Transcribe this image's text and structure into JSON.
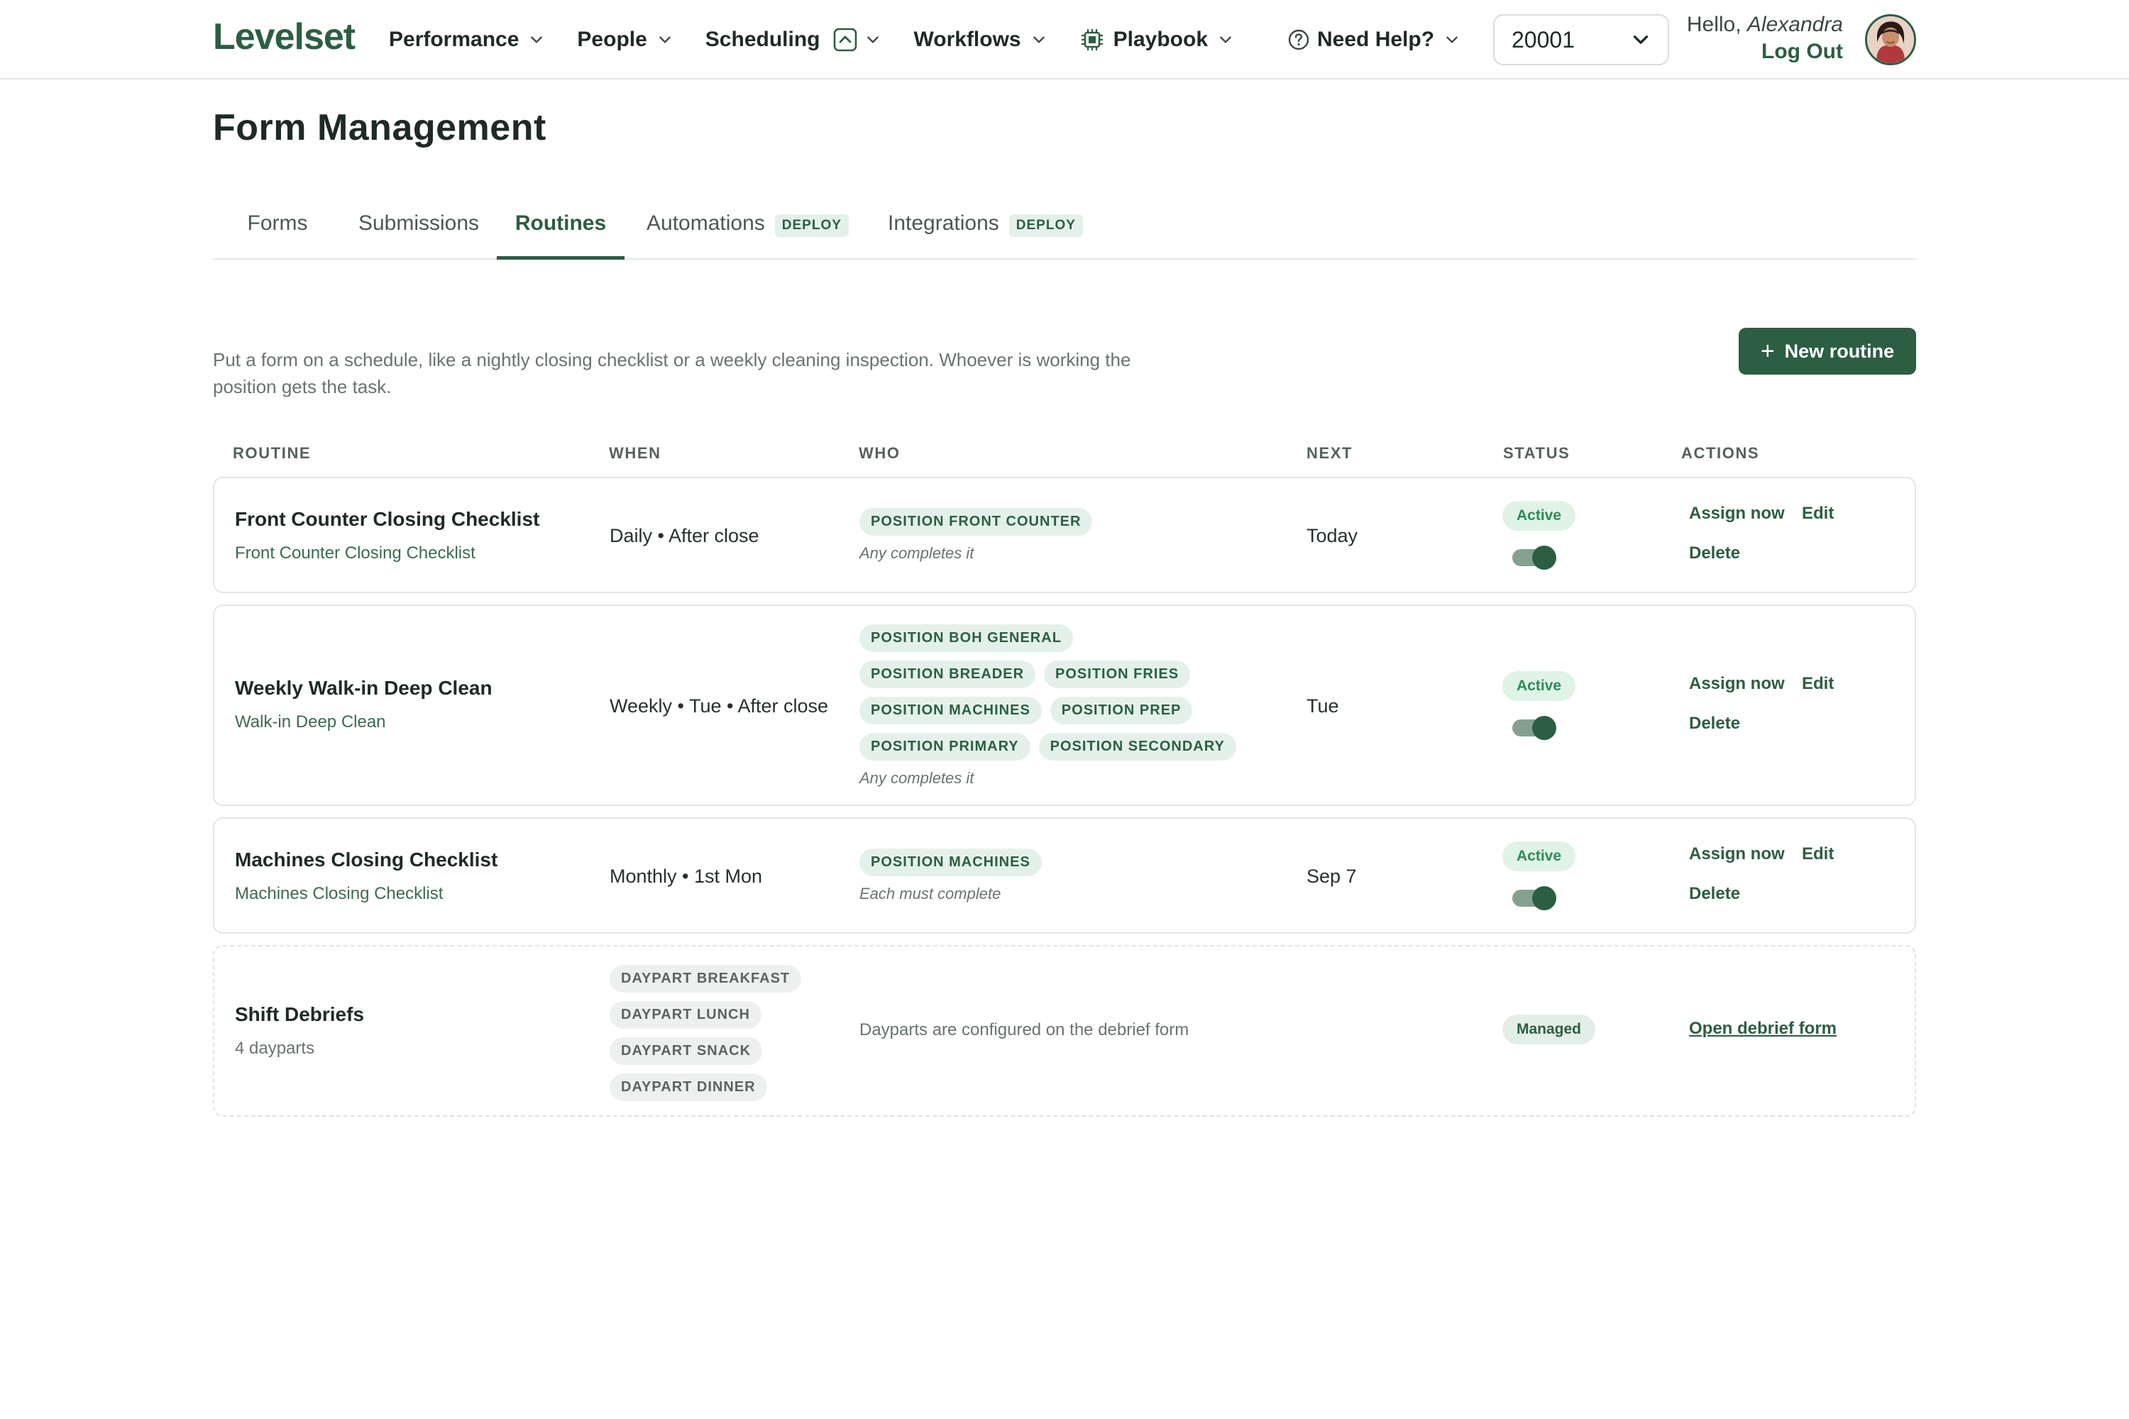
{
  "app": {
    "logo": "Levelset",
    "nav": [
      {
        "label": "Performance"
      },
      {
        "label": "People"
      },
      {
        "label": "Scheduling"
      },
      {
        "label": "Workflows"
      },
      {
        "label": "Playbook"
      }
    ],
    "help_label": "Need Help?",
    "location_value": "20001",
    "greeting_hello": "Hello,",
    "greeting_name": "Alexandra",
    "logout_label": "Log Out"
  },
  "page": {
    "title": "Form Management",
    "tabs": [
      {
        "label": "Forms"
      },
      {
        "label": "Submissions"
      },
      {
        "label": "Routines",
        "active": true
      },
      {
        "label": "Automations",
        "badge": "DEPLOY"
      },
      {
        "label": "Integrations",
        "badge": "DEPLOY"
      }
    ],
    "description": "Put a form on a schedule, like a nightly closing checklist or a weekly cleaning inspection. Whoever is working the position gets the task.",
    "new_button_label": "New routine"
  },
  "table": {
    "headers": [
      "ROUTINE",
      "WHEN",
      "WHO",
      "NEXT",
      "STATUS",
      "ACTIONS"
    ],
    "rows": [
      {
        "title": "Front Counter Closing Checklist",
        "form": "Front Counter Closing Checklist",
        "when": "Daily • After close",
        "who": [
          "POSITION FRONT COUNTER"
        ],
        "completion": "Any completes it",
        "next": "Today",
        "status": "Active",
        "toggle_on": true,
        "actions": {
          "assign": "Assign now",
          "edit": "Edit",
          "delete": "Delete"
        }
      },
      {
        "title": "Weekly Walk-in Deep Clean",
        "form": "Walk-in Deep Clean",
        "when": "Weekly • Tue • After close",
        "who": [
          "POSITION BOH GENERAL",
          "POSITION BREADER",
          "POSITION FRIES",
          "POSITION MACHINES",
          "POSITION PREP",
          "POSITION PRIMARY",
          "POSITION SECONDARY"
        ],
        "completion": "Any completes it",
        "next": "Tue",
        "status": "Active",
        "toggle_on": true,
        "actions": {
          "assign": "Assign now",
          "edit": "Edit",
          "delete": "Delete"
        }
      },
      {
        "title": "Machines Closing Checklist",
        "form": "Machines Closing Checklist",
        "when": "Monthly • 1st Mon",
        "who": [
          "POSITION MACHINES"
        ],
        "completion": "Each must complete",
        "next": "Sep 7",
        "status": "Active",
        "toggle_on": true,
        "actions": {
          "assign": "Assign now",
          "edit": "Edit",
          "delete": "Delete"
        }
      },
      {
        "title": "Shift Debriefs",
        "form": "4 dayparts",
        "when_chips": [
          "DAYPART BREAKFAST",
          "DAYPART LUNCH",
          "DAYPART SNACK",
          "DAYPART DINNER"
        ],
        "who_note": "Dayparts are configured on the debrief form",
        "status": "Managed",
        "actions": {
          "open": "Open debrief form"
        }
      }
    ]
  },
  "colors": {
    "brand": "#2c5e42",
    "chip_bg": "#e4f1ea",
    "active_text": "#2f8a58"
  },
  "icons": [
    "chevron-down-icon",
    "scheduling-caret-up-icon",
    "playbook-chip-icon",
    "help-circle-icon",
    "plus-icon"
  ]
}
